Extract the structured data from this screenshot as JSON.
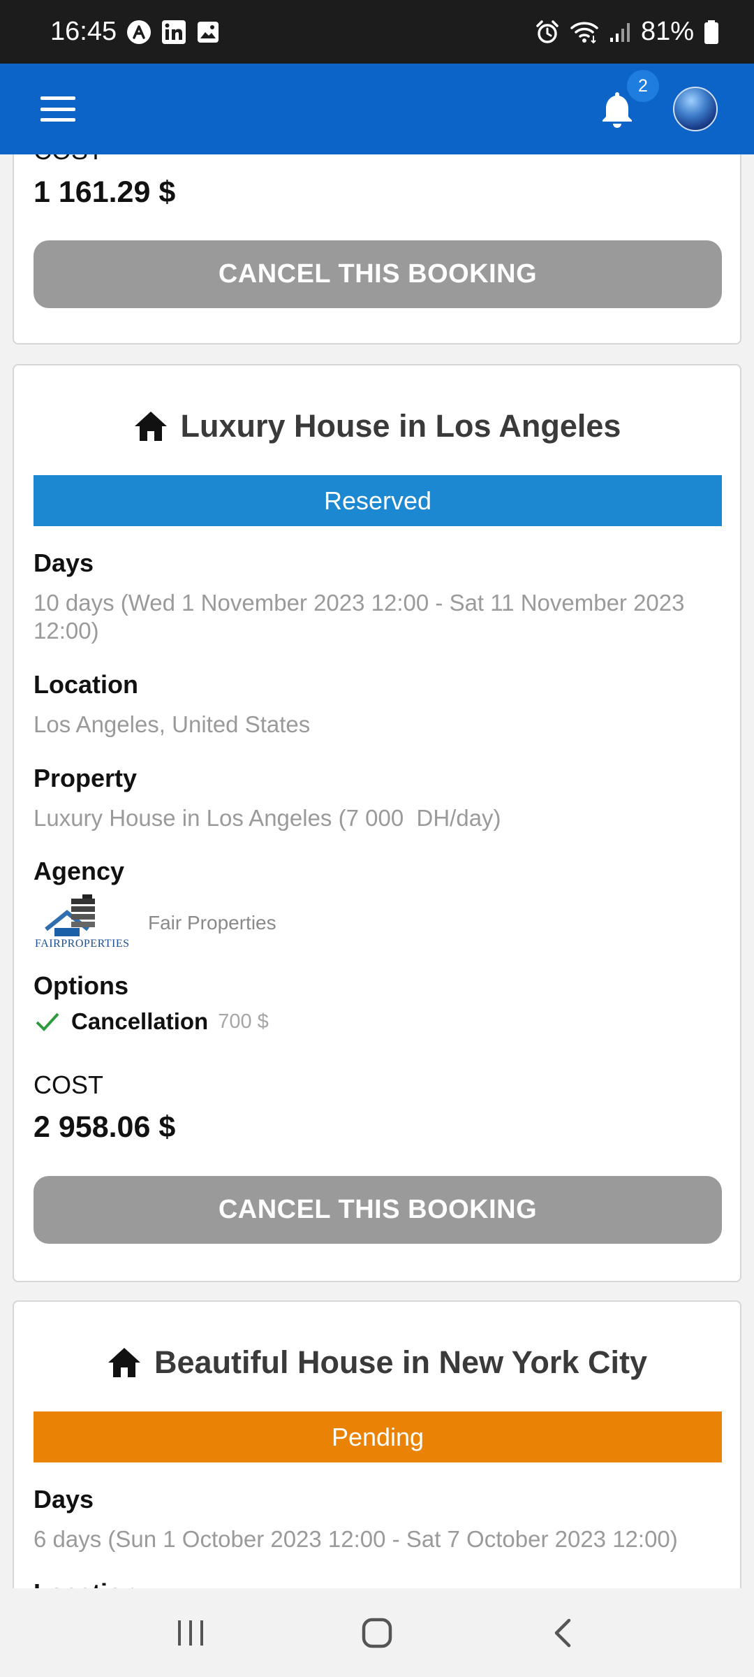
{
  "status_bar": {
    "time": "16:45",
    "battery": "81%"
  },
  "app_bar": {
    "notification_count": "2"
  },
  "bookings": [
    {
      "partial_cost_label": "COST",
      "cost": "1 161.29 $",
      "cancel_label": "CANCEL THIS BOOKING"
    },
    {
      "title": "Luxury House in Los Angeles",
      "status": "Reserved",
      "status_color": "#1c88d1",
      "days_label": "Days",
      "days_value": "10 days (Wed 1 November 2023 12:00 - Sat 11 November 2023 12:00)",
      "location_label": "Location",
      "location_value": "Los Angeles, United States",
      "property_label": "Property",
      "property_value": "Luxury House in Los Angeles (7 000  DH/day)",
      "agency_label": "Agency",
      "agency_name": "Fair Properties",
      "agency_logo_text": "FAIRPROPERTIES",
      "options_label": "Options",
      "option_name": "Cancellation",
      "option_price": "700 $",
      "cost_label": "COST",
      "cost": "2 958.06 $",
      "cancel_label": "CANCEL THIS BOOKING"
    },
    {
      "title": "Beautiful House in New York City",
      "status": "Pending",
      "status_color": "#ea8205",
      "days_label": "Days",
      "days_value": "6 days (Sun 1 October 2023 12:00 - Sat 7 October 2023 12:00)",
      "location_label": "Location"
    }
  ],
  "icons": {
    "menu": "hamburger-icon",
    "bell": "bell-icon",
    "home": "home-icon",
    "check": "check-icon",
    "nav_recent": "recent-apps-icon",
    "nav_home": "nav-home-icon",
    "nav_back": "back-icon"
  }
}
